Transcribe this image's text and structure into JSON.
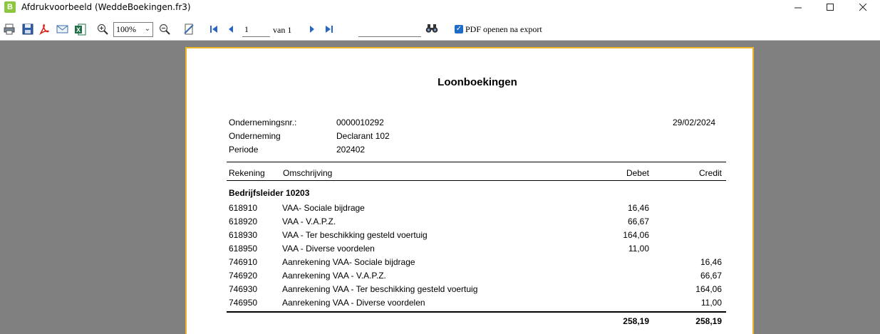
{
  "window": {
    "title": "Afdrukvoorbeeld (WeddeBoekingen.fr3)",
    "app_icon_letter": "B"
  },
  "toolbar": {
    "zoom_value": "100%",
    "page_number": "1",
    "page_total_label": "van 1",
    "search_value": "",
    "pdf_open_checked": true,
    "pdf_open_label": "PDF openen na export"
  },
  "report": {
    "title": "Loonboekingen",
    "header": {
      "company_nr_label": "Ondernemingsnr.:",
      "company_nr_value": "0000010292",
      "company_label": "Onderneming",
      "company_value": "Declarant 102",
      "period_label": "Periode",
      "period_value": "202402",
      "date": "29/02/2024"
    },
    "columns": {
      "account": "Rekening",
      "description": "Omschrijving",
      "debit": "Debet",
      "credit": "Credit"
    },
    "group_title": "Bedrijfsleider 10203",
    "rows": [
      {
        "account": "618910",
        "description": "VAA- Sociale bijdrage",
        "debit": "16,46",
        "credit": ""
      },
      {
        "account": "618920",
        "description": "VAA - V.A.P.Z.",
        "debit": "66,67",
        "credit": ""
      },
      {
        "account": "618930",
        "description": "VAA - Ter beschikking gesteld voertuig",
        "debit": "164,06",
        "credit": ""
      },
      {
        "account": "618950",
        "description": "VAA - Diverse voordelen",
        "debit": "11,00",
        "credit": ""
      },
      {
        "account": "746910",
        "description": "Aanrekening VAA- Sociale bijdrage",
        "debit": "",
        "credit": "16,46"
      },
      {
        "account": "746920",
        "description": "Aanrekening VAA - V.A.P.Z.",
        "debit": "",
        "credit": "66,67"
      },
      {
        "account": "746930",
        "description": "Aanrekening VAA - Ter beschikking gesteld voertuig",
        "debit": "",
        "credit": "164,06"
      },
      {
        "account": "746950",
        "description": "Aanrekening VAA - Diverse voordelen",
        "debit": "",
        "credit": "11,00"
      }
    ],
    "totals": {
      "debit": "258,19",
      "credit": "258,19"
    }
  }
}
